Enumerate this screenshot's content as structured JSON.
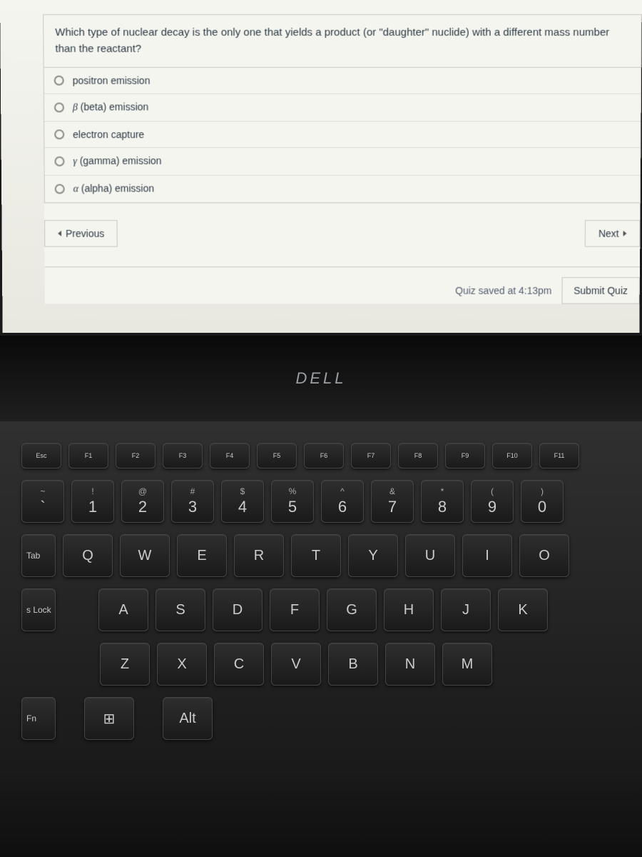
{
  "question": {
    "prefix": "Which type of nuclear decay is the ",
    "underlined": "only",
    "mid": " one that yields a product (or \"daughter\" nuclide) with a different ",
    "bold": "mass number",
    "suffix": " than the reactant?"
  },
  "options": [
    {
      "label": "positron emission",
      "greek": ""
    },
    {
      "label": " (beta) emission",
      "greek": "β"
    },
    {
      "label": "electron capture",
      "greek": ""
    },
    {
      "label": " (gamma) emission",
      "greek": "γ"
    },
    {
      "label": " (alpha) emission",
      "greek": "α"
    }
  ],
  "nav": {
    "previous": "Previous",
    "next": "Next"
  },
  "status": "Quiz saved at 4:13pm",
  "submit": "Submit Quiz",
  "brand": "DELL",
  "keyboard": {
    "fn_row": [
      "Esc",
      "F1",
      "F2",
      "F3",
      "F4",
      "F5",
      "F6",
      "F7",
      "F8",
      "F9",
      "F10",
      "F11"
    ],
    "num_row": [
      {
        "t": "~",
        "b": "`"
      },
      {
        "t": "!",
        "b": "1"
      },
      {
        "t": "@",
        "b": "2"
      },
      {
        "t": "#",
        "b": "3"
      },
      {
        "t": "$",
        "b": "4"
      },
      {
        "t": "%",
        "b": "5"
      },
      {
        "t": "^",
        "b": "6"
      },
      {
        "t": "&",
        "b": "7"
      },
      {
        "t": "*",
        "b": "8"
      },
      {
        "t": "(",
        "b": "9"
      },
      {
        "t": ")",
        "b": "0"
      }
    ],
    "row_q": [
      "Q",
      "W",
      "E",
      "R",
      "T",
      "Y",
      "U",
      "I",
      "O"
    ],
    "row_a": [
      "A",
      "S",
      "D",
      "F",
      "G",
      "H",
      "J",
      "K"
    ],
    "row_z": [
      "Z",
      "X",
      "C",
      "V",
      "B",
      "N",
      "M"
    ],
    "side": {
      "tab": "Tab",
      "caps": "s Lock",
      "fn": "Fn",
      "alt": "Alt"
    }
  }
}
